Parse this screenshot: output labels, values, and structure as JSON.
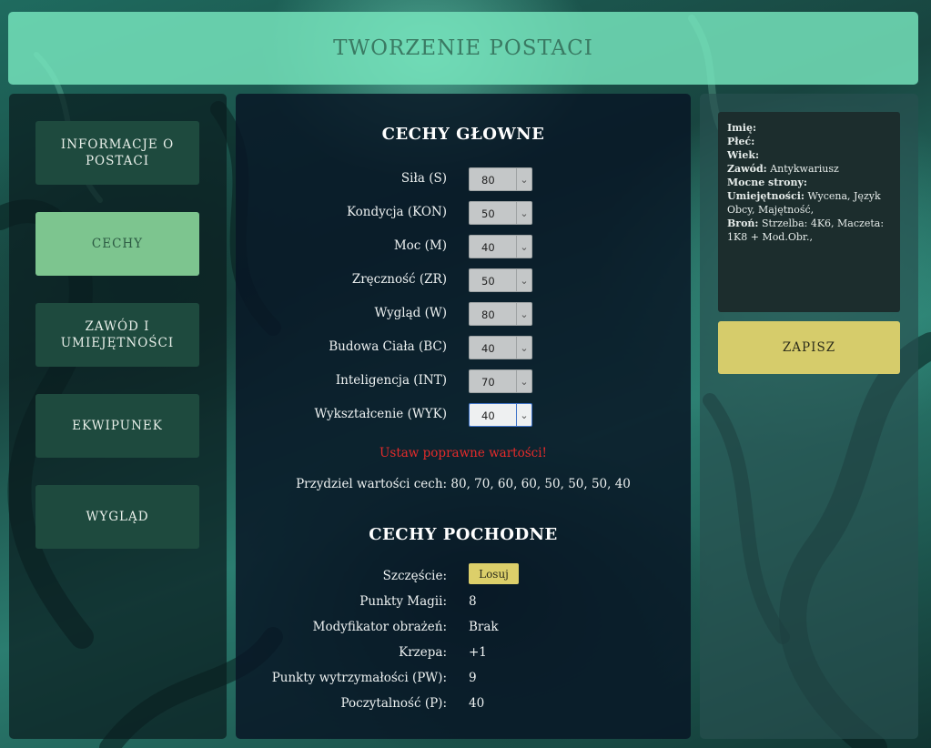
{
  "header": {
    "title": "TWORZENIE POSTACI"
  },
  "nav": {
    "items": [
      {
        "label": "INFORMACJE O POSTACI",
        "active": false
      },
      {
        "label": "CECHY",
        "active": true
      },
      {
        "label": "ZAWÓD I UMIEJĘTNOŚCI",
        "active": false
      },
      {
        "label": "EKWIPUNEK",
        "active": false
      },
      {
        "label": "WYGLĄD",
        "active": false
      }
    ]
  },
  "main_attributes": {
    "title": "CECHY GŁOWNE",
    "items": [
      {
        "label": "Siła (S)",
        "value": "80"
      },
      {
        "label": "Kondycja (KON)",
        "value": "50"
      },
      {
        "label": "Moc (M)",
        "value": "40"
      },
      {
        "label": "Zręczność (ZR)",
        "value": "50"
      },
      {
        "label": "Wygląd (W)",
        "value": "80"
      },
      {
        "label": "Budowa Ciała (BC)",
        "value": "40"
      },
      {
        "label": "Inteligencja (INT)",
        "value": "70"
      },
      {
        "label": "Wykształcenie (WYK)",
        "value": "40"
      }
    ],
    "error": "Ustaw poprawne wartości!",
    "assign_note": "Przydziel wartości cech: 80, 70, 60, 60, 50, 50, 50, 40"
  },
  "derived_attributes": {
    "title": "CECHY POCHODNE",
    "luck_label": "Szczęście:",
    "roll_label": "Losuj",
    "items": [
      {
        "label": "Punkty Magii:",
        "value": "8"
      },
      {
        "label": "Modyfikator obrażeń:",
        "value": "Brak"
      },
      {
        "label": "Krzepa:",
        "value": "+1"
      },
      {
        "label": "Punkty wytrzymałości (PW):",
        "value": "9"
      },
      {
        "label": "Poczytalność (P):",
        "value": "40"
      }
    ]
  },
  "summary": {
    "name_label": "Imię:",
    "name_value": "",
    "gender_label": "Płeć:",
    "gender_value": "",
    "age_label": "Wiek:",
    "age_value": "",
    "profession_label": "Zawód:",
    "profession_value": "Antykwariusz",
    "strengths_label": "Mocne strony:",
    "strengths_value": "",
    "skills_label": "Umiejętności:",
    "skills_value": "Wycena, Język Obcy, Majętność,",
    "weapon_label": "Broń:",
    "weapon_value": "Strzelba: 4K6, Maczeta: 1K8 + Mod.Obr.,"
  },
  "save_label": "ZAPISZ",
  "colors": {
    "accent_active_nav": "#7dc58f",
    "save_button": "#d6cc6b",
    "error": "#e52b2b"
  }
}
